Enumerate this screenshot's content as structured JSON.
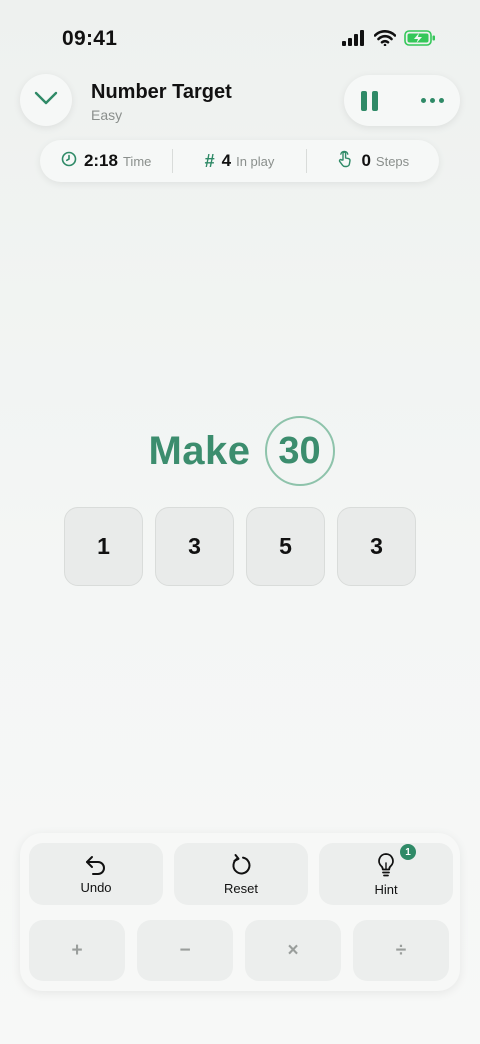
{
  "status_bar": {
    "time": "09:41",
    "icons": [
      "cellular-signal-icon",
      "wifi-icon",
      "battery-charging-icon"
    ]
  },
  "header": {
    "title": "Number Target",
    "difficulty": "Easy",
    "back_icon": "chevron-down-icon",
    "pause_icon": "pause-icon",
    "more_icon": "more-dots-icon"
  },
  "stats": {
    "time": {
      "value": "2:18",
      "label": "Time",
      "icon": "clock-icon"
    },
    "in_play": {
      "value": "4",
      "label": "In play",
      "icon": "hash-icon",
      "symbol": "#"
    },
    "steps": {
      "value": "0",
      "label": "Steps",
      "icon": "tap-hand-icon"
    }
  },
  "target": {
    "prefix": "Make",
    "number": "30"
  },
  "tiles": [
    "1",
    "3",
    "5",
    "3"
  ],
  "actions": {
    "undo": {
      "label": "Undo",
      "icon": "undo-arrow-icon"
    },
    "reset": {
      "label": "Reset",
      "icon": "reset-rotate-icon"
    },
    "hint": {
      "label": "Hint",
      "icon": "lightbulb-icon",
      "badge": "1"
    }
  },
  "operators": [
    "+",
    "−",
    "×",
    "÷"
  ],
  "colors": {
    "accent": "#2f8a67",
    "target_text": "#3c8d6e",
    "target_ring": "#8ec3ab",
    "battery": "#34c759"
  }
}
